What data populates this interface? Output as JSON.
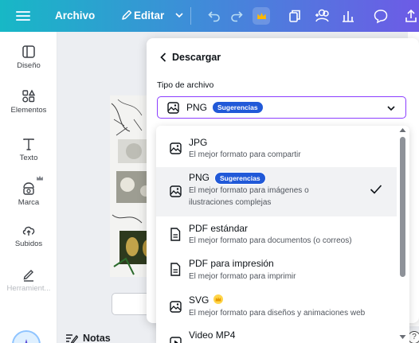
{
  "topbar": {
    "archivo_label": "Archivo",
    "editar_label": "Editar",
    "icons": [
      "menu-icon",
      "pencil-icon",
      "chevron-down-icon",
      "undo-icon",
      "redo-icon",
      "crown-icon",
      "copy-icon",
      "add-people-icon",
      "chart-icon",
      "comment-icon",
      "share-icon"
    ]
  },
  "sidebar": {
    "items": [
      {
        "label": "Diseño",
        "icon": "layout-icon"
      },
      {
        "label": "Elementos",
        "icon": "elements-icon"
      },
      {
        "label": "Texto",
        "icon": "text-icon"
      },
      {
        "label": "Marca",
        "icon": "brand-icon"
      },
      {
        "label": "Subidos",
        "icon": "upload-cloud-icon"
      },
      {
        "label": "Herramient...",
        "icon": "draw-icon"
      }
    ]
  },
  "panel": {
    "back_label": "Descargar",
    "file_type_label": "Tipo de archivo",
    "selected_value": "PNG",
    "selected_badge": "Sugerencias"
  },
  "dropdown": {
    "options": [
      {
        "title": "JPG",
        "desc": "El mejor formato para compartir",
        "icon": "image-icon"
      },
      {
        "title": "PNG",
        "badge": "Sugerencias",
        "desc1": "El mejor formato para imágenes o",
        "desc2": "ilustraciones complejas",
        "icon": "image-icon",
        "selected": true
      },
      {
        "title": "PDF estándar",
        "desc": "El mejor formato para documentos (o correos)",
        "icon": "document-icon"
      },
      {
        "title": "PDF para impresión",
        "desc": "El mejor formato para imprimir",
        "icon": "document-icon"
      },
      {
        "title": "SVG",
        "desc": "El mejor formato para diseños y animaciones web",
        "icon": "image-icon",
        "premium": true
      },
      {
        "title": "Video MP4",
        "icon": "video-icon"
      }
    ]
  },
  "footer": {
    "notas_label": "Notas",
    "help_label": "?"
  },
  "colors": {
    "accent": "#8b3dff",
    "badge": "#2159d8",
    "crown": "#ffb800"
  }
}
